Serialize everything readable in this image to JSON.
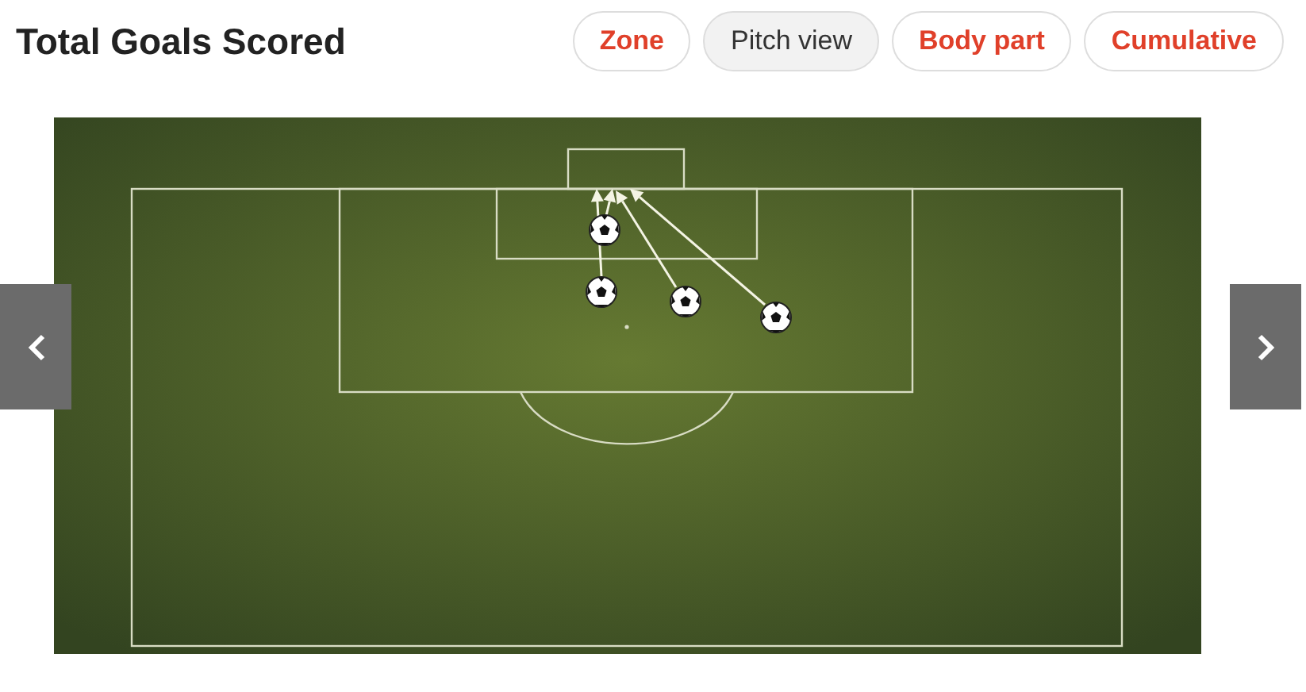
{
  "title": "Total Goals Scored",
  "tabs": [
    {
      "label": "Zone",
      "selected": false
    },
    {
      "label": "Pitch view",
      "selected": true
    },
    {
      "label": "Body part",
      "selected": false
    },
    {
      "label": "Cumulative",
      "selected": false
    }
  ]
}
